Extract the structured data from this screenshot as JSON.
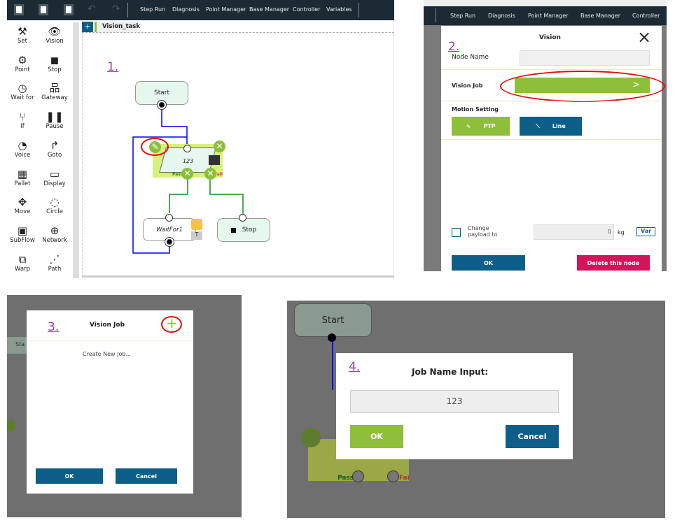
{
  "panel1": {
    "step": "1.",
    "toolbar": {
      "icons": [
        "new-file-icon",
        "save-file-icon",
        "export-file-icon",
        "undo-icon",
        "redo-icon"
      ],
      "nav": [
        "Step Run",
        "Diagnosis",
        "Point Manager",
        "Base Manager",
        "Controller",
        "Variables"
      ]
    },
    "palette": [
      {
        "label": "Set",
        "icon": "tools-icon"
      },
      {
        "label": "Vision",
        "icon": "eye-icon"
      },
      {
        "label": "Point",
        "icon": "robot-arm-icon"
      },
      {
        "label": "Stop",
        "icon": "stop-icon"
      },
      {
        "label": "Wait for",
        "icon": "clock-icon"
      },
      {
        "label": "Gateway",
        "icon": "hierarchy-icon"
      },
      {
        "label": "If",
        "icon": "branch-icon"
      },
      {
        "label": "Pause",
        "icon": "pause-icon"
      },
      {
        "label": "Voice",
        "icon": "voice-icon"
      },
      {
        "label": "Goto",
        "icon": "goto-arrow-icon"
      },
      {
        "label": "Pallet",
        "icon": "grid-icon"
      },
      {
        "label": "Display",
        "icon": "display-icon"
      },
      {
        "label": "Move",
        "icon": "move-icon"
      },
      {
        "label": "Circle",
        "icon": "circle-icon"
      },
      {
        "label": "SubFlow",
        "icon": "subflow-icon"
      },
      {
        "label": "Network",
        "icon": "globe-icon"
      },
      {
        "label": "Warp",
        "icon": "warp-icon"
      },
      {
        "label": "Path",
        "icon": "path-icon"
      }
    ],
    "tab": {
      "add": "+",
      "name": "Vision_task"
    },
    "flow": {
      "start": "Start",
      "vision_node": "123",
      "pass": "Pass",
      "fail": "Fail",
      "waitfor": "WaitFor1",
      "timer_badge": "T",
      "stop": "Stop"
    }
  },
  "panel2": {
    "step": "2.",
    "nav": [
      "Step Run",
      "Diagnosis",
      "Point Manager",
      "Base Manager",
      "Controller"
    ],
    "title": "Vision",
    "close": "×",
    "node_name_label": "Node Name",
    "node_name_value": "",
    "vision_job_label": "Vision Job",
    "vision_job_arrow": ">",
    "motion_label": "Motion Setting",
    "ptp": "PTP",
    "line": "Line",
    "payload_label": "Change payload to",
    "payload_value": "0",
    "payload_unit": "kg",
    "var": "Var",
    "ok": "OK",
    "delete": "Delete this node"
  },
  "panel3": {
    "step": "3.",
    "title": "Vision Job",
    "add": "+",
    "create": "Create New Job...",
    "ok": "OK",
    "cancel": "Cancel",
    "bg_start": "Sta"
  },
  "panel4": {
    "step": "4.",
    "title": "Job Name Input:",
    "value": "123",
    "ok": "OK",
    "cancel": "Cancel",
    "bg_start": "Start",
    "bg_pass": "Pass",
    "bg_fail": "Fai"
  },
  "colors": {
    "green": "#8dbf3a",
    "blue": "#0d5f8a",
    "magenta": "#d4145a",
    "topbar": "#1b2a33",
    "highlight": "#e01010"
  }
}
